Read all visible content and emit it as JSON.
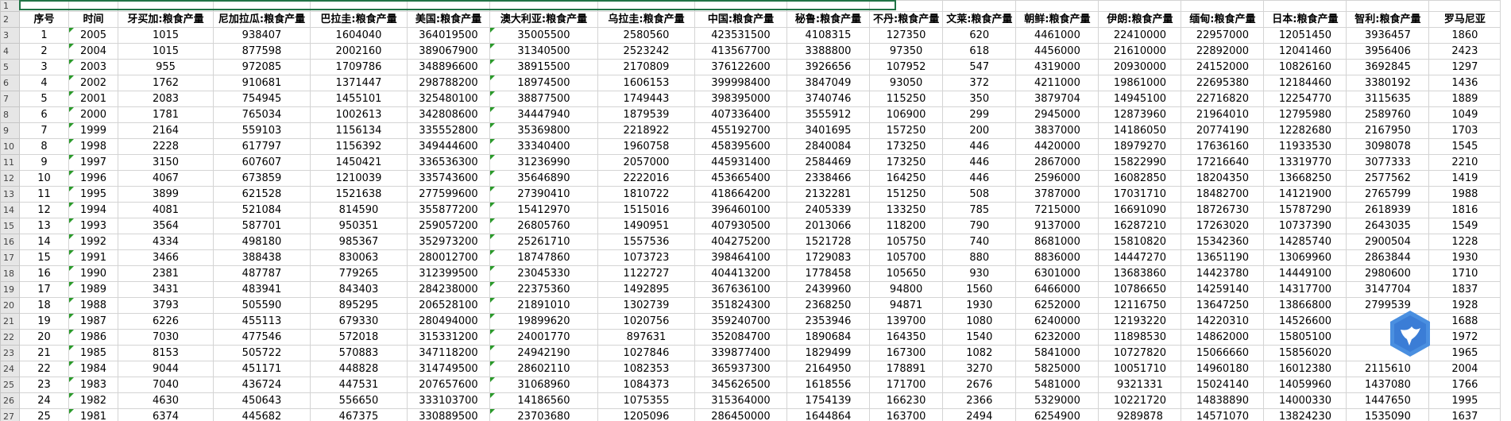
{
  "sheet": {
    "top_row_number": "1",
    "headers": [
      "序号",
      "时间",
      "牙买加:粮食产量",
      "尼加拉瓜:粮食产量",
      "巴拉圭:粮食产量",
      "美国:粮食产量",
      "澳大利亚:粮食产量",
      "乌拉圭:粮食产量",
      "中国:粮食产量",
      "秘鲁:粮食产量",
      "不丹:粮食产量",
      "文莱:粮食产量",
      "朝鲜:粮食产量",
      "伊朗:粮食产量",
      "缅甸:粮食产量",
      "日本:粮食产量",
      "智利:粮食产量",
      "罗马尼亚"
    ],
    "rows": [
      {
        "n": "3",
        "cells": [
          "1",
          "2005",
          "1015",
          "938407",
          "1604040",
          "364019500",
          "35005500",
          "2580560",
          "423531500",
          "4108315",
          "127350",
          "620",
          "4461000",
          "22410000",
          "22957000",
          "12051450",
          "3936457",
          "1860"
        ]
      },
      {
        "n": "4",
        "cells": [
          "2",
          "2004",
          "1015",
          "877598",
          "2002160",
          "389067900",
          "31340500",
          "2523242",
          "413567700",
          "3388800",
          "97350",
          "618",
          "4456000",
          "21610000",
          "22892000",
          "12041460",
          "3956406",
          "2423"
        ]
      },
      {
        "n": "5",
        "cells": [
          "3",
          "2003",
          "955",
          "972085",
          "1709786",
          "348896600",
          "38915500",
          "2170809",
          "376122600",
          "3926656",
          "107952",
          "547",
          "4319000",
          "20930000",
          "24152000",
          "10826160",
          "3692845",
          "1297"
        ]
      },
      {
        "n": "6",
        "cells": [
          "4",
          "2002",
          "1762",
          "910681",
          "1371447",
          "298788200",
          "18974500",
          "1606153",
          "399998400",
          "3847049",
          "93050",
          "372",
          "4211000",
          "19861000",
          "22695380",
          "12184460",
          "3380192",
          "1436"
        ]
      },
      {
        "n": "7",
        "cells": [
          "5",
          "2001",
          "2083",
          "754945",
          "1455101",
          "325480100",
          "38877500",
          "1749443",
          "398395000",
          "3740746",
          "115250",
          "350",
          "3879704",
          "14945100",
          "22716820",
          "12254770",
          "3115635",
          "1889"
        ]
      },
      {
        "n": "8",
        "cells": [
          "6",
          "2000",
          "1781",
          "765034",
          "1002613",
          "342808600",
          "34447940",
          "1879539",
          "407336400",
          "3555912",
          "106900",
          "299",
          "2945000",
          "12873960",
          "21964010",
          "12795980",
          "2589760",
          "1049"
        ]
      },
      {
        "n": "9",
        "cells": [
          "7",
          "1999",
          "2164",
          "559103",
          "1156134",
          "335552800",
          "35369800",
          "2218922",
          "455192700",
          "3401695",
          "157250",
          "200",
          "3837000",
          "14186050",
          "20774190",
          "12282680",
          "2167950",
          "1703"
        ]
      },
      {
        "n": "10",
        "cells": [
          "8",
          "1998",
          "2228",
          "617797",
          "1156392",
          "349444600",
          "33340400",
          "1960758",
          "458395600",
          "2840084",
          "173250",
          "446",
          "4420000",
          "18979270",
          "17636160",
          "11933530",
          "3098078",
          "1545"
        ]
      },
      {
        "n": "11",
        "cells": [
          "9",
          "1997",
          "3150",
          "607607",
          "1450421",
          "336536300",
          "31236990",
          "2057000",
          "445931400",
          "2584469",
          "173250",
          "446",
          "2867000",
          "15822990",
          "17216640",
          "13319770",
          "3077333",
          "2210"
        ]
      },
      {
        "n": "12",
        "cells": [
          "10",
          "1996",
          "4067",
          "673859",
          "1210039",
          "335743600",
          "35646890",
          "2222016",
          "453665400",
          "2338466",
          "164250",
          "446",
          "2596000",
          "16082850",
          "18204350",
          "13668250",
          "2577562",
          "1419"
        ]
      },
      {
        "n": "13",
        "cells": [
          "11",
          "1995",
          "3899",
          "621528",
          "1521638",
          "277599600",
          "27390410",
          "1810722",
          "418664200",
          "2132281",
          "151250",
          "508",
          "3787000",
          "17031710",
          "18482700",
          "14121900",
          "2765799",
          "1988"
        ]
      },
      {
        "n": "14",
        "cells": [
          "12",
          "1994",
          "4081",
          "521084",
          "814590",
          "355877200",
          "15412970",
          "1515016",
          "396460100",
          "2405339",
          "133250",
          "785",
          "7215000",
          "16691090",
          "18726730",
          "15787290",
          "2618939",
          "1816"
        ]
      },
      {
        "n": "15",
        "cells": [
          "13",
          "1993",
          "3564",
          "587701",
          "950351",
          "259057200",
          "26805760",
          "1490951",
          "407930500",
          "2013066",
          "118200",
          "790",
          "9137000",
          "16287210",
          "17263020",
          "10737390",
          "2643035",
          "1549"
        ]
      },
      {
        "n": "16",
        "cells": [
          "14",
          "1992",
          "4334",
          "498180",
          "985367",
          "352973200",
          "25261710",
          "1557536",
          "404275200",
          "1521728",
          "105750",
          "740",
          "8681000",
          "15810820",
          "15342360",
          "14285740",
          "2900504",
          "1228"
        ]
      },
      {
        "n": "17",
        "cells": [
          "15",
          "1991",
          "3466",
          "388438",
          "830063",
          "280012700",
          "18747860",
          "1073723",
          "398464100",
          "1729083",
          "105700",
          "880",
          "8836000",
          "14447270",
          "13651190",
          "13069960",
          "2863844",
          "1930"
        ]
      },
      {
        "n": "18",
        "cells": [
          "16",
          "1990",
          "2381",
          "487787",
          "779265",
          "312399500",
          "23045330",
          "1122727",
          "404413200",
          "1778458",
          "105650",
          "930",
          "6301000",
          "13683860",
          "14423780",
          "14449100",
          "2980600",
          "1710"
        ]
      },
      {
        "n": "19",
        "cells": [
          "17",
          "1989",
          "3431",
          "483941",
          "843403",
          "284238000",
          "22375360",
          "1492895",
          "367636100",
          "2439960",
          "94800",
          "1560",
          "6466000",
          "10786650",
          "14259140",
          "14317700",
          "3147704",
          "1837"
        ]
      },
      {
        "n": "20",
        "cells": [
          "18",
          "1988",
          "3793",
          "505590",
          "895295",
          "206528100",
          "21891010",
          "1302739",
          "351824300",
          "2368250",
          "94871",
          "1930",
          "6252000",
          "12116750",
          "13647250",
          "13866800",
          "2799539",
          "1928"
        ]
      },
      {
        "n": "21",
        "cells": [
          "19",
          "1987",
          "6226",
          "455113",
          "679330",
          "280494000",
          "19899620",
          "1020756",
          "359240700",
          "2353946",
          "139700",
          "1080",
          "6240000",
          "12193220",
          "14220310",
          "14526600",
          "",
          "1688"
        ]
      },
      {
        "n": "22",
        "cells": [
          "20",
          "1986",
          "7030",
          "477546",
          "572018",
          "315331200",
          "24001770",
          "897631",
          "352084700",
          "1890684",
          "164350",
          "1540",
          "6232000",
          "11898530",
          "14862000",
          "15805100",
          "",
          "1972"
        ]
      },
      {
        "n": "23",
        "cells": [
          "21",
          "1985",
          "8153",
          "505722",
          "570883",
          "347118200",
          "24942190",
          "1027846",
          "339877400",
          "1829499",
          "167300",
          "1082",
          "5841000",
          "10727820",
          "15066660",
          "15856020",
          "",
          "1965"
        ]
      },
      {
        "n": "24",
        "cells": [
          "22",
          "1984",
          "9044",
          "451171",
          "448828",
          "314749500",
          "28602110",
          "1082353",
          "365937300",
          "2164950",
          "178891",
          "3270",
          "5825000",
          "10051710",
          "14960180",
          "16012380",
          "2115610",
          "2004"
        ]
      },
      {
        "n": "25",
        "cells": [
          "23",
          "1983",
          "7040",
          "436724",
          "447531",
          "207657600",
          "31068960",
          "1084373",
          "345626500",
          "1618556",
          "171700",
          "2676",
          "5481000",
          "9321331",
          "15024140",
          "14059960",
          "1437080",
          "1766"
        ]
      },
      {
        "n": "26",
        "cells": [
          "24",
          "1982",
          "4630",
          "450643",
          "556650",
          "333103700",
          "14186560",
          "1075355",
          "315364000",
          "1754139",
          "166230",
          "2366",
          "5329000",
          "10221720",
          "14838890",
          "14000330",
          "1447650",
          "1995"
        ]
      },
      {
        "n": "27",
        "cells": [
          "25",
          "1981",
          "6374",
          "445682",
          "467375",
          "330889500",
          "23703680",
          "1205096",
          "286450000",
          "1644864",
          "163700",
          "2494",
          "6254900",
          "9289878",
          "14571070",
          "13824230",
          "1535090",
          "1637"
        ]
      }
    ]
  },
  "colors": {
    "selection": "#217346",
    "comment_marker": "#2a9a2a",
    "logo": "#4a8fe0"
  }
}
